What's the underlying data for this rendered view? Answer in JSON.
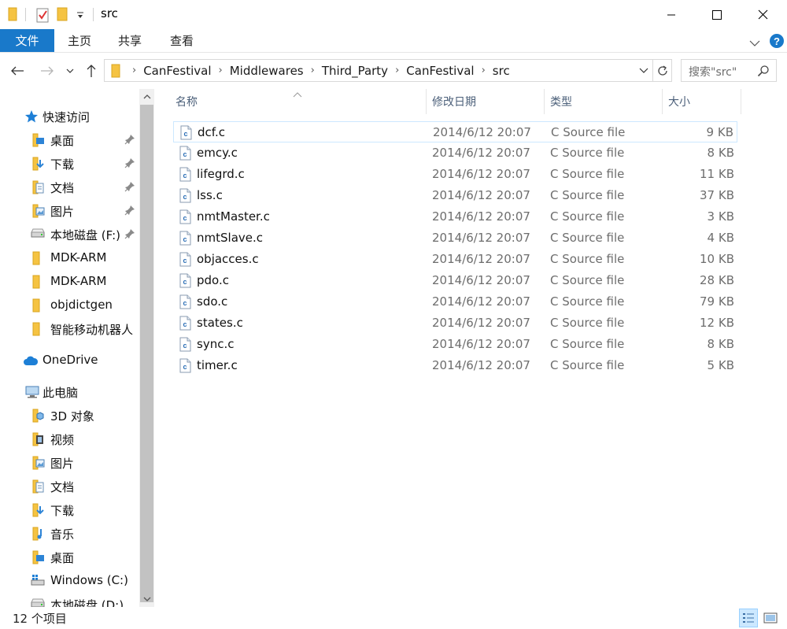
{
  "window": {
    "title": "src",
    "accent": "#1979ca"
  },
  "ribbon": {
    "tabs": [
      "文件",
      "主页",
      "共享",
      "查看"
    ]
  },
  "address": {
    "crumbs": [
      "CanFestival",
      "Middlewares",
      "Third_Party",
      "CanFestival",
      "src"
    ],
    "search_placeholder": "搜索\"src\""
  },
  "sidebar": {
    "quick_access": "快速访问",
    "quick_items": [
      {
        "label": "桌面",
        "icon": "desktop-folder-icon",
        "pinned": true
      },
      {
        "label": "下载",
        "icon": "downloads-folder-icon",
        "pinned": true
      },
      {
        "label": "文档",
        "icon": "documents-folder-icon",
        "pinned": true
      },
      {
        "label": "图片",
        "icon": "pictures-folder-icon",
        "pinned": true
      },
      {
        "label": "本地磁盘 (F:)",
        "icon": "drive-icon",
        "pinned": true
      },
      {
        "label": "MDK-ARM",
        "icon": "folder-icon",
        "pinned": false
      },
      {
        "label": "MDK-ARM",
        "icon": "folder-icon",
        "pinned": false
      },
      {
        "label": "objdictgen",
        "icon": "folder-icon",
        "pinned": false
      },
      {
        "label": "智能移动机器人",
        "icon": "folder-icon",
        "pinned": false
      }
    ],
    "onedrive": "OneDrive",
    "this_pc": "此电脑",
    "pc_items": [
      {
        "label": "3D 对象",
        "icon": "3d-objects-folder-icon"
      },
      {
        "label": "视频",
        "icon": "videos-folder-icon"
      },
      {
        "label": "图片",
        "icon": "pictures-folder-icon"
      },
      {
        "label": "文档",
        "icon": "documents-folder-icon"
      },
      {
        "label": "下载",
        "icon": "downloads-folder-icon"
      },
      {
        "label": "音乐",
        "icon": "music-folder-icon"
      },
      {
        "label": "桌面",
        "icon": "desktop-folder-icon"
      },
      {
        "label": "Windows (C:)",
        "icon": "windows-drive-icon"
      },
      {
        "label": "本地磁盘 (D:)",
        "icon": "drive-icon"
      }
    ]
  },
  "columns": {
    "name": "名称",
    "date": "修改日期",
    "type": "类型",
    "size": "大小"
  },
  "files": [
    {
      "name": "dcf.c",
      "date": "2014/6/12 20:07",
      "type": "C Source file",
      "size": "9 KB"
    },
    {
      "name": "emcy.c",
      "date": "2014/6/12 20:07",
      "type": "C Source file",
      "size": "8 KB"
    },
    {
      "name": "lifegrd.c",
      "date": "2014/6/12 20:07",
      "type": "C Source file",
      "size": "11 KB"
    },
    {
      "name": "lss.c",
      "date": "2014/6/12 20:07",
      "type": "C Source file",
      "size": "37 KB"
    },
    {
      "name": "nmtMaster.c",
      "date": "2014/6/12 20:07",
      "type": "C Source file",
      "size": "3 KB"
    },
    {
      "name": "nmtSlave.c",
      "date": "2014/6/12 20:07",
      "type": "C Source file",
      "size": "4 KB"
    },
    {
      "name": "objacces.c",
      "date": "2014/6/12 20:07",
      "type": "C Source file",
      "size": "10 KB"
    },
    {
      "name": "pdo.c",
      "date": "2014/6/12 20:07",
      "type": "C Source file",
      "size": "28 KB"
    },
    {
      "name": "sdo.c",
      "date": "2014/6/12 20:07",
      "type": "C Source file",
      "size": "79 KB"
    },
    {
      "name": "states.c",
      "date": "2014/6/12 20:07",
      "type": "C Source file",
      "size": "12 KB"
    },
    {
      "name": "sync.c",
      "date": "2014/6/12 20:07",
      "type": "C Source file",
      "size": "8 KB"
    },
    {
      "name": "timer.c",
      "date": "2014/6/12 20:07",
      "type": "C Source file",
      "size": "5 KB"
    }
  ],
  "status": {
    "count": "12 个项目"
  }
}
